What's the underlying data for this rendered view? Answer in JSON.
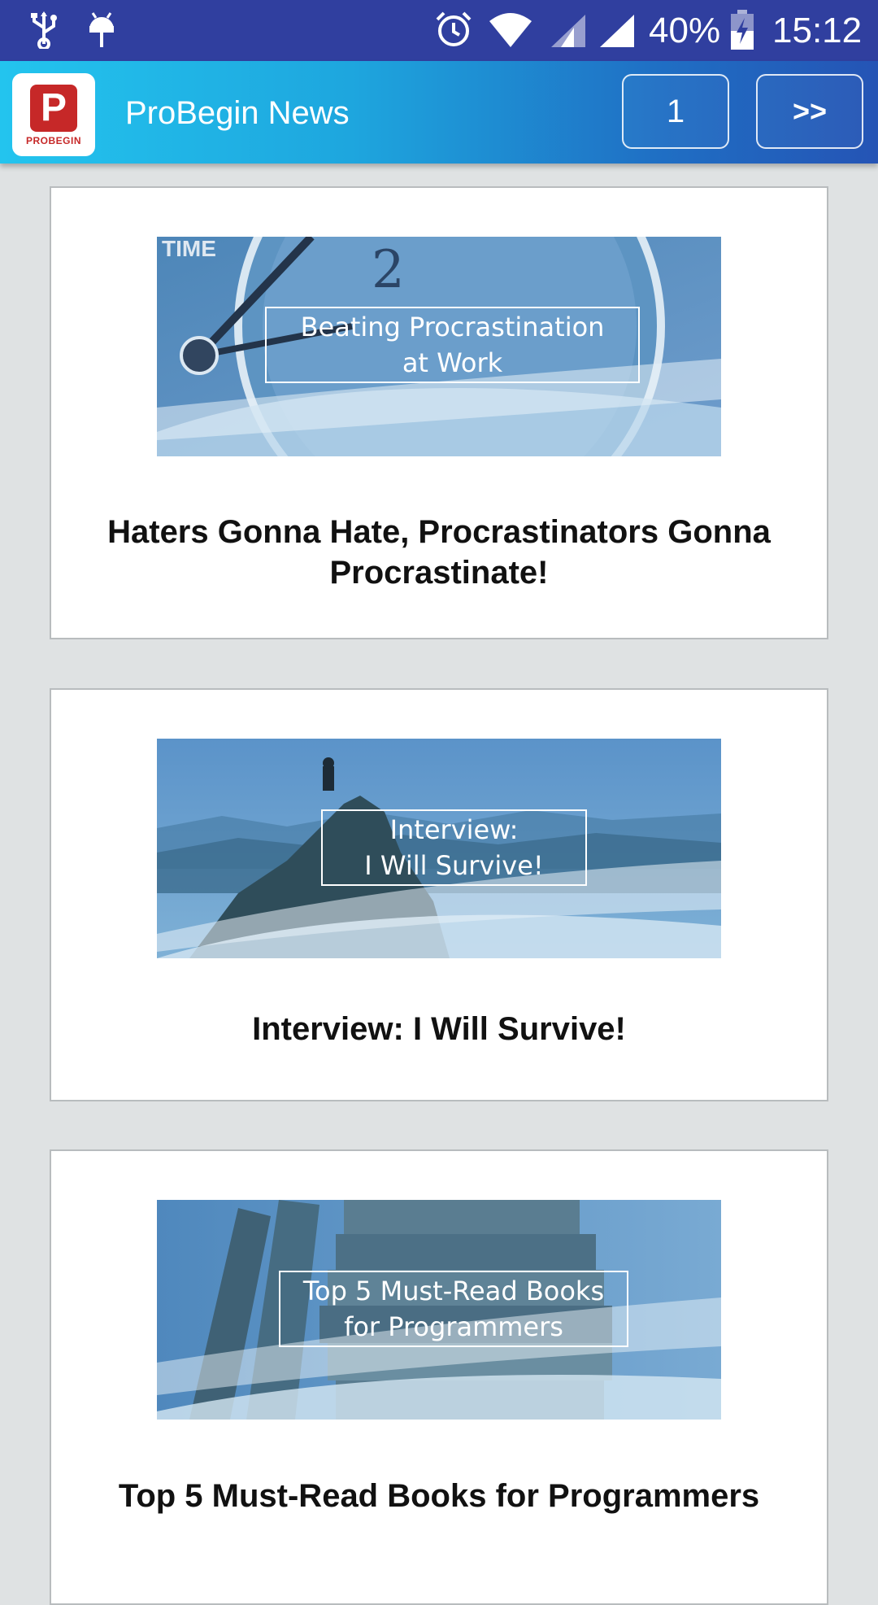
{
  "status_bar": {
    "battery": "40%",
    "time": "15:12",
    "icons": [
      "usb-icon",
      "android-debug-icon",
      "alarm-icon",
      "wifi-icon",
      "signal-icon",
      "signal-icon",
      "battery-charging-icon"
    ]
  },
  "app_bar": {
    "logo_text": "PROBEGIN",
    "logo_letter": "P",
    "title": "ProBegin News",
    "page_number": "1",
    "next_label": ">>"
  },
  "articles": [
    {
      "image_caption_line1": "Beating Procrastination",
      "image_caption_line2": "at Work",
      "image_text": "TIME",
      "title": "Haters Gonna Hate, Procrastinators Gonna Procrastinate!"
    },
    {
      "image_caption_line1": "Interview:",
      "image_caption_line2": "I Will Survive!",
      "title": "Interview: I Will Survive!"
    },
    {
      "image_caption_line1": "Top 5 Must-Read Books",
      "image_caption_line2": "for Programmers",
      "title": "Top 5 Must-Read Books for Programmers"
    }
  ],
  "colors": {
    "status_bar": "#303f9f",
    "app_bar_start": "#23c4ee",
    "app_bar_end": "#2554b5",
    "background": "#dfe2e3",
    "logo_red": "#c62828"
  }
}
